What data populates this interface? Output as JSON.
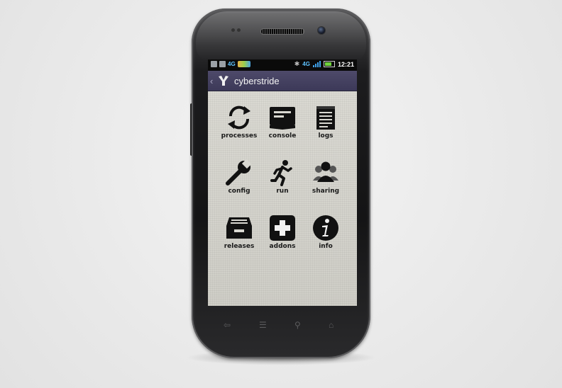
{
  "statusbar": {
    "network": "4G",
    "network_right": "4G",
    "time": "12:21",
    "icons": [
      "checkbox-icon",
      "download-icon",
      "signal-4g-icon",
      "rainbow-app-icon",
      "bluetooth-icon",
      "signal-bars-icon",
      "battery-icon"
    ]
  },
  "actionbar": {
    "title": "cyberstride",
    "logo": "cyberstride-logo-icon"
  },
  "menu": {
    "items": [
      {
        "label": "processes",
        "icon": "refresh-icon"
      },
      {
        "label": "console",
        "icon": "console-icon"
      },
      {
        "label": "logs",
        "icon": "notepad-icon"
      },
      {
        "label": "config",
        "icon": "wrench-icon"
      },
      {
        "label": "run",
        "icon": "running-man-icon"
      },
      {
        "label": "sharing",
        "icon": "people-icon"
      },
      {
        "label": "releases",
        "icon": "inbox-tray-icon"
      },
      {
        "label": "addons",
        "icon": "plus-box-icon"
      },
      {
        "label": "info",
        "icon": "info-icon"
      }
    ]
  },
  "navbar": {
    "buttons": [
      "back-icon",
      "menu-icon",
      "search-icon",
      "home-icon"
    ]
  },
  "colors": {
    "actionbar": "#3c3958",
    "screen_bg": "#d9d8d1",
    "icon": "#111111",
    "accent_blue": "#3ea0e8"
  }
}
